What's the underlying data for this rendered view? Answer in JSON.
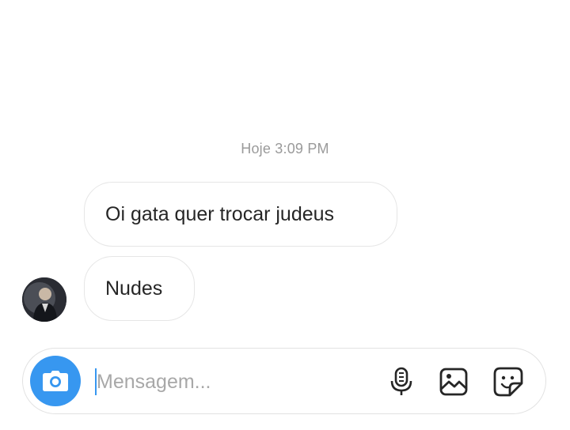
{
  "thread": {
    "timestamp": "Hoje 3:09 PM",
    "messages": [
      {
        "text": "Oi gata quer trocar judeus"
      },
      {
        "text": "Nudes"
      }
    ]
  },
  "composer": {
    "placeholder": "Mensagem...",
    "accent_color": "#3797f0",
    "icons": [
      "camera-icon",
      "microphone-icon",
      "gallery-icon",
      "sticker-icon"
    ]
  }
}
